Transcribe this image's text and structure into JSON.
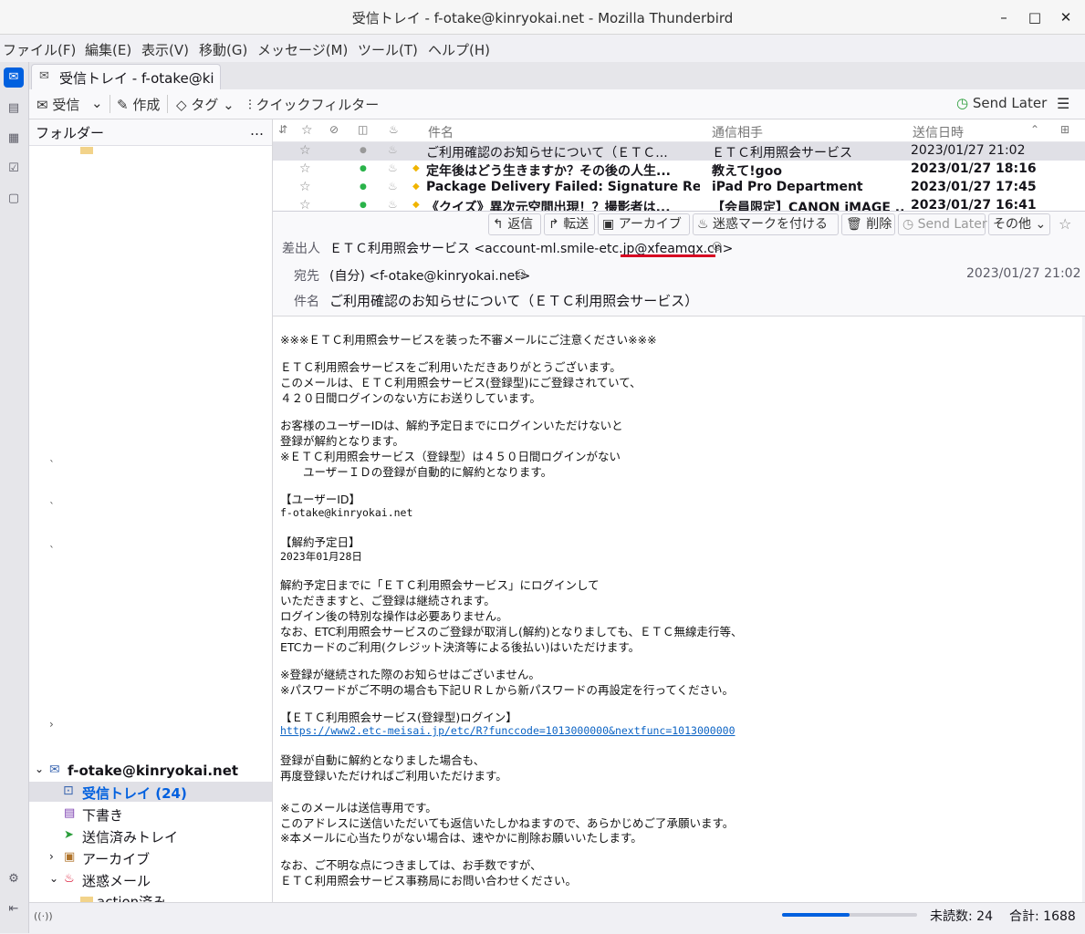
{
  "window": {
    "title": "受信トレイ - f-otake@kinryokai.net - Mozilla Thunderbird",
    "min": "–",
    "max": "□",
    "close": "✕"
  },
  "menubar": [
    "ファイル(F)",
    "編集(E)",
    "表示(V)",
    "移動(G)",
    "メッセージ(M)",
    "ツール(T)",
    "ヘルプ(H)"
  ],
  "tab": {
    "label": "受信トレイ - f-otake@kin"
  },
  "toolbar": {
    "get": "受信",
    "write": "作成",
    "tag": "タグ",
    "quickfilter": "クイックフィルター",
    "sendlater": "Send Later"
  },
  "folderpane": {
    "title": "フォルダー",
    "more": "…",
    "account": "f-otake@kinryokai.net",
    "folders": [
      {
        "label": "受信トレイ (24)"
      },
      {
        "label": "下書き"
      },
      {
        "label": "送信済みトレイ"
      },
      {
        "label": "アーカイブ"
      },
      {
        "label": "迷惑メール"
      },
      {
        "label": "action済み"
      }
    ]
  },
  "threads": {
    "columns": {
      "subject": "件名",
      "correspondent": "通信相手",
      "date": "送信日時"
    },
    "rows": [
      {
        "subject": "ご利用確認のお知らせについて（ＥＴＣ...",
        "from": "ＥＴＣ利用照会サービス",
        "date": "2023/01/27 21:02",
        "bold": false,
        "selected": true
      },
      {
        "subject": "定年後はどう生きますか？その後の人生...",
        "from": "教えて!goo",
        "date": "2023/01/27 18:16",
        "bold": true,
        "selected": false
      },
      {
        "subject": "Package Delivery Failed: Signature Requi...",
        "from": "iPad Pro Department",
        "date": "2023/01/27 17:45",
        "bold": true,
        "selected": false
      },
      {
        "subject": "《クイズ》異次元空間出現！？撮影者は...",
        "from": "【会員限定】CANON iMAGE ...",
        "date": "2023/01/27 16:41",
        "bold": true,
        "selected": false
      }
    ]
  },
  "header": {
    "buttons": {
      "reply": "返信",
      "forward": "転送",
      "archive": "アーカイブ",
      "junk": "迷惑マークを付ける",
      "delete": "削除",
      "sendlater": "Send Later",
      "other": "その他"
    },
    "from_label": "差出人",
    "from": "ＥＴＣ利用照会サービス <account-ml.smile-etc.jp@xfeamqx.cn>",
    "to_label": "宛先",
    "to": "(自分) <f-otake@kinryokai.net>",
    "date": "2023/01/27 21:02",
    "subject_label": "件名",
    "subject": "ご利用確認のお知らせについて（ＥＴＣ利用照会サービス）"
  },
  "body": {
    "lines": [
      "※※※ＥＴＣ利用照会サービスを装った不審メールにご注意ください※※※",
      "ＥＴＣ利用照会サービスをご利用いただきありがとうございます。",
      "このメールは、ＥＴＣ利用照会サービス(登録型)にご登録されていて、",
      "４２０日間ログインのない方にお送りしています。",
      "お客様のユーザーIDは、解約予定日までにログインいただけないと",
      "登録が解約となります。",
      "※ＥＴＣ利用照会サービス（登録型）は４５０日間ログインがない",
      "　　ユーザーＩＤの登録が自動的に解約となります。",
      "【ユーザーID】",
      "f-otake@kinryokai.net",
      "【解約予定日】",
      "2023年01月28日",
      "解約予定日までに「ＥＴＣ利用照会サービス」にログインして",
      "いただきますと、ご登録は継続されます。",
      "ログイン後の特別な操作は必要ありません。",
      "なお、ETC利用照会サービスのご登録が取消し(解約)となりましても、ＥＴＣ無線走行等、",
      "ETCカードのご利用(クレジット決済等による後払い)はいただけます。",
      "※登録が継続された際のお知らせはございません。",
      "※パスワードがご不明の場合も下記ＵＲＬから新パスワードの再設定を行ってください。",
      "【ＥＴＣ利用照会サービス(登録型)ログイン】",
      "https://www2.etc-meisai.jp/etc/R?funccode=1013000000&nextfunc=1013000000",
      "登録が自動に解約となりました場合も、",
      "再度登録いただければご利用いただけます。",
      "※このメールは送信専用です。",
      "このアドレスに送信いただいても返信いたしかねますので、あらかじめご了承願います。",
      "※本メールに心当たりがない場合は、速やかに削除お願いいたします。",
      "なお、ご不明な点につきましては、お手数ですが、",
      "ＥＴＣ利用照会サービス事務局にお問い合わせください。"
    ]
  },
  "status": {
    "unread": "未読数: 24",
    "total": "合計: 1688",
    "progress": 0.5
  },
  "colors": {
    "accent": "#0060df",
    "underline": "#d70022",
    "link": "#0b63c4"
  }
}
